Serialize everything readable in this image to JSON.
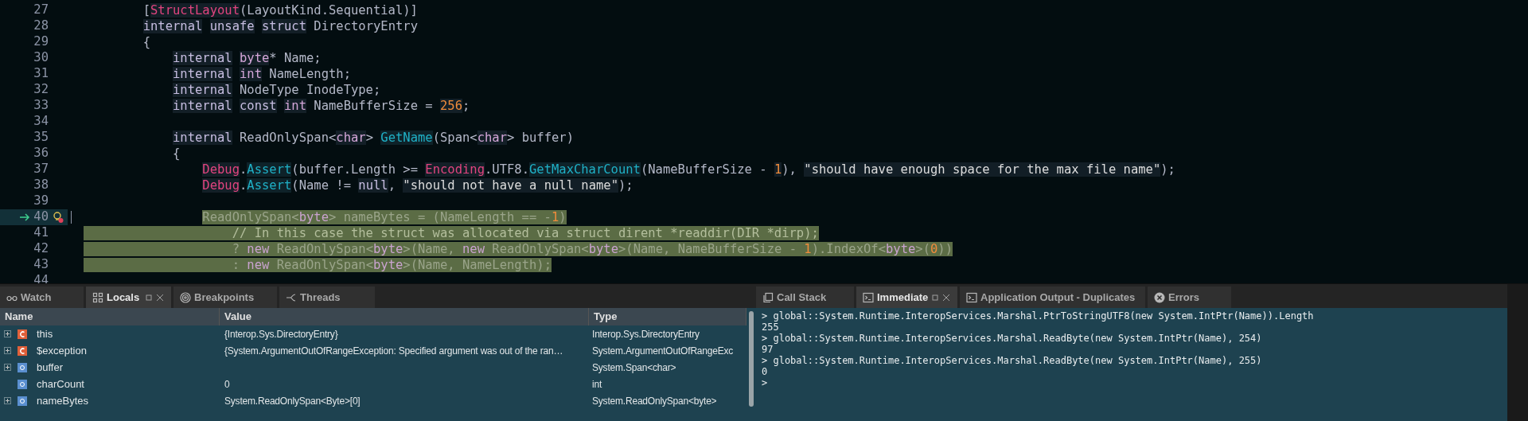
{
  "editor": {
    "lines": [
      {
        "number": "27",
        "current": false,
        "highlighted": false,
        "tokens": [
          {
            "kind": "plain",
            "t": "        ["
          },
          {
            "kind": "attr",
            "t": "StructLayout"
          },
          {
            "kind": "plain",
            "t": "(LayoutKind.Sequential)]"
          }
        ]
      },
      {
        "number": "28",
        "current": false,
        "highlighted": false,
        "tokens": [
          {
            "kind": "kw",
            "t": "        internal "
          },
          {
            "kind": "kw",
            "t": "unsafe "
          },
          {
            "kind": "kw",
            "t": "struct"
          },
          {
            "kind": "plain",
            "t": " DirectoryEntry"
          }
        ]
      },
      {
        "number": "29",
        "current": false,
        "highlighted": false,
        "tokens": [
          {
            "kind": "plain",
            "t": "        {"
          }
        ]
      },
      {
        "number": "30",
        "current": false,
        "highlighted": false,
        "tokens": [
          {
            "kind": "kw",
            "t": "            internal "
          },
          {
            "kind": "type",
            "t": "byte"
          },
          {
            "kind": "plain",
            "t": "* Name;"
          }
        ]
      },
      {
        "number": "31",
        "current": false,
        "highlighted": false,
        "tokens": [
          {
            "kind": "kw",
            "t": "            internal "
          },
          {
            "kind": "type",
            "t": "int"
          },
          {
            "kind": "plain",
            "t": " NameLength;"
          }
        ]
      },
      {
        "number": "32",
        "current": false,
        "highlighted": false,
        "tokens": [
          {
            "kind": "kw",
            "t": "            internal"
          },
          {
            "kind": "plain",
            "t": " NodeType InodeType;"
          }
        ]
      },
      {
        "number": "33",
        "current": false,
        "highlighted": false,
        "tokens": [
          {
            "kind": "kw",
            "t": "            internal "
          },
          {
            "kind": "kw",
            "t": "const "
          },
          {
            "kind": "type",
            "t": "int"
          },
          {
            "kind": "plain",
            "t": " NameBufferSize = "
          },
          {
            "kind": "num",
            "t": "256"
          },
          {
            "kind": "plain",
            "t": ";"
          }
        ]
      },
      {
        "number": "34",
        "current": false,
        "highlighted": false
      },
      {
        "number": "35",
        "current": false,
        "highlighted": false,
        "tokens": [
          {
            "kind": "kw",
            "t": "            internal"
          },
          {
            "kind": "plain",
            "t": " ReadOnlySpan<"
          },
          {
            "kind": "type",
            "t": "char"
          },
          {
            "kind": "plain",
            "t": "> "
          },
          {
            "kind": "method",
            "t": "GetName"
          },
          {
            "kind": "plain",
            "t": "(Span<"
          },
          {
            "kind": "type",
            "t": "char"
          },
          {
            "kind": "plain",
            "t": "> buffer)"
          }
        ]
      },
      {
        "number": "36",
        "current": false,
        "highlighted": false,
        "tokens": [
          {
            "kind": "plain",
            "t": "            {"
          }
        ]
      },
      {
        "number": "37",
        "current": false,
        "highlighted": false,
        "tokens": [
          {
            "kind": "attr",
            "t": "                Debug"
          },
          {
            "kind": "plain",
            "t": "."
          },
          {
            "kind": "method",
            "t": "Assert"
          },
          {
            "kind": "plain",
            "t": "(buffer.Length >= "
          },
          {
            "kind": "attr",
            "t": "Encoding"
          },
          {
            "kind": "plain",
            "t": ".UTF8."
          },
          {
            "kind": "method",
            "t": "GetMaxCharCount"
          },
          {
            "kind": "plain",
            "t": "(NameBufferSize - "
          },
          {
            "kind": "num",
            "t": "1"
          },
          {
            "kind": "plain",
            "t": "), "
          },
          {
            "kind": "str",
            "t": "\"should have enough space for the max file name\""
          },
          {
            "kind": "plain",
            "t": ");"
          }
        ]
      },
      {
        "number": "38",
        "current": false,
        "highlighted": false,
        "tokens": [
          {
            "kind": "attr",
            "t": "                Debug"
          },
          {
            "kind": "plain",
            "t": "."
          },
          {
            "kind": "method",
            "t": "Assert"
          },
          {
            "kind": "plain",
            "t": "(Name != "
          },
          {
            "kind": "kw",
            "t": "null"
          },
          {
            "kind": "plain",
            "t": ", "
          },
          {
            "kind": "str",
            "t": "\"should not have a null name\""
          },
          {
            "kind": "plain",
            "t": ");"
          }
        ]
      },
      {
        "number": "39",
        "current": false,
        "highlighted": false
      },
      {
        "number": "40",
        "current": true,
        "highlighted": true,
        "tokens": [
          {
            "kind": "plain",
            "t": "                ReadOnlySpan<"
          },
          {
            "kind": "type",
            "t": "byte"
          },
          {
            "kind": "plain",
            "t": "> nameBytes = (NameLength == -"
          },
          {
            "kind": "num",
            "t": "1"
          },
          {
            "kind": "plain",
            "t": ")"
          }
        ]
      },
      {
        "number": "41",
        "current": false,
        "highlighted": true,
        "tokens": [
          {
            "kind": "comment",
            "t": "                    // In this case the struct was allocated via struct dirent *readdir(DIR *dirp);"
          }
        ]
      },
      {
        "number": "42",
        "current": false,
        "highlighted": true,
        "tokens": [
          {
            "kind": "plain",
            "t": "                    ? "
          },
          {
            "kind": "kw",
            "t": "new"
          },
          {
            "kind": "plain",
            "t": " ReadOnlySpan<"
          },
          {
            "kind": "type",
            "t": "byte"
          },
          {
            "kind": "plain",
            "t": ">(Name, "
          },
          {
            "kind": "kw",
            "t": "new"
          },
          {
            "kind": "plain",
            "t": " ReadOnlySpan<"
          },
          {
            "kind": "type",
            "t": "byte"
          },
          {
            "kind": "plain",
            "t": ">(Name, NameBufferSize - "
          },
          {
            "kind": "num",
            "t": "1"
          },
          {
            "kind": "plain",
            "t": ").IndexOf<"
          },
          {
            "kind": "type",
            "t": "byte"
          },
          {
            "kind": "plain",
            "t": ">("
          },
          {
            "kind": "num",
            "t": "0"
          },
          {
            "kind": "plain",
            "t": "))"
          }
        ]
      },
      {
        "number": "43",
        "current": false,
        "highlighted": true,
        "tokens": [
          {
            "kind": "plain",
            "t": "                    : "
          },
          {
            "kind": "kw",
            "t": "new"
          },
          {
            "kind": "plain",
            "t": " ReadOnlySpan<"
          },
          {
            "kind": "type",
            "t": "byte"
          },
          {
            "kind": "plain",
            "t": ">(Name, NameLength);"
          }
        ]
      },
      {
        "number": "44",
        "current": false,
        "highlighted": false
      }
    ]
  },
  "left_panel": {
    "tabs": [
      {
        "label": "Watch",
        "kind": "watch",
        "selected": false
      },
      {
        "label": "Locals",
        "kind": "locals",
        "selected": true
      },
      {
        "label": "Breakpoints",
        "kind": "breakpoints",
        "selected": false
      },
      {
        "label": "Threads",
        "kind": "threads",
        "selected": false
      }
    ],
    "columns": [
      "Name",
      "Value",
      "Type"
    ],
    "rows": [
      {
        "expandable": true,
        "kind": "class",
        "name": "this",
        "value": "{Interop.Sys.DirectoryEntry}",
        "type": "Interop.Sys.DirectoryEntry"
      },
      {
        "expandable": true,
        "kind": "class",
        "name": "$exception",
        "value": "{System.ArgumentOutOfRangeException: Specified argument was out of the ran…",
        "type": "System.ArgumentOutOfRangeExc"
      },
      {
        "expandable": true,
        "kind": "field",
        "name": "buffer",
        "type": "System.Span<char>"
      },
      {
        "expandable": false,
        "kind": "field",
        "name": "charCount",
        "value": "0",
        "type": "int"
      },
      {
        "expandable": true,
        "kind": "field",
        "name": "nameBytes",
        "value": "System.ReadOnlySpan<Byte>[0]",
        "type": "System.ReadOnlySpan<byte>"
      }
    ]
  },
  "right_panel": {
    "tabs": [
      {
        "label": "Call Stack",
        "kind": "call_stack",
        "selected": false
      },
      {
        "label": "Immediate",
        "kind": "console",
        "selected": true
      },
      {
        "label": "Application Output - Duplicates",
        "kind": "console",
        "selected": false
      },
      {
        "label": "Errors",
        "kind": "errors",
        "selected": false
      }
    ],
    "output": [
      "> global::System.Runtime.InteropServices.Marshal.PtrToStringUTF8(new System.IntPtr(Name)).Length",
      "255",
      "> global::System.Runtime.InteropServices.Marshal.ReadByte(new System.IntPtr(Name), 254)",
      "97",
      "> global::System.Runtime.InteropServices.Marshal.ReadByte(new System.IntPtr(Name), 255)",
      "0",
      ">"
    ]
  }
}
